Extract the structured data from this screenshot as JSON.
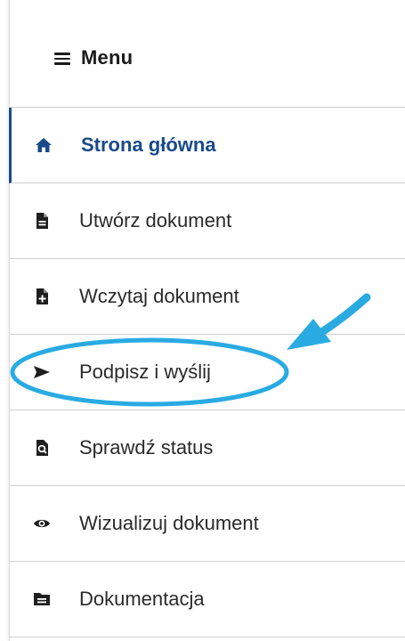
{
  "menu": {
    "title": "Menu",
    "icon": "hamburger-icon"
  },
  "nav": {
    "items": [
      {
        "label": "Strona główna",
        "icon": "home-icon",
        "active": true
      },
      {
        "label": "Utwórz dokument",
        "icon": "document-icon",
        "active": false
      },
      {
        "label": "Wczytaj dokument",
        "icon": "document-add-icon",
        "active": false
      },
      {
        "label": "Podpisz i wyślij",
        "icon": "send-icon",
        "active": false,
        "highlighted": true
      },
      {
        "label": "Sprawdź status",
        "icon": "document-search-icon",
        "active": false
      },
      {
        "label": "Wizualizuj dokument",
        "icon": "eye-icon",
        "active": false
      },
      {
        "label": "Dokumentacja",
        "icon": "folder-icon",
        "active": false
      }
    ]
  },
  "colors": {
    "accent": "#1a4a8a",
    "text": "#2a2a2a",
    "annotation": "#29abe2"
  }
}
